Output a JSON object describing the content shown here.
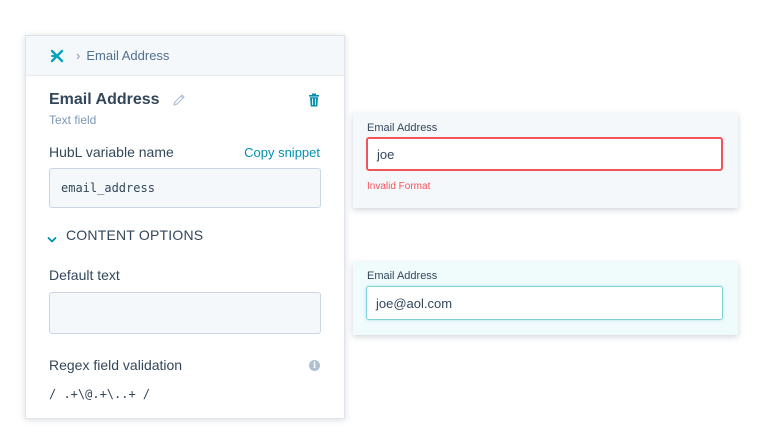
{
  "panel": {
    "breadcrumb_sep": "›",
    "breadcrumb_label": "Email Address",
    "field_title": "Email Address",
    "field_type": "Text field",
    "hubl_label": "HubL variable name",
    "copy_snippet": "Copy snippet",
    "hubl_value": "email_address",
    "content_options": "CONTENT OPTIONS",
    "default_text_label": "Default text",
    "default_text_value": "",
    "regex_label": "Regex field validation",
    "regex_value": "/ .+\\@.+\\..+ /"
  },
  "preview_invalid": {
    "label": "Email Address",
    "value": "joe",
    "error": "Invalid Format"
  },
  "preview_valid": {
    "label": "Email Address",
    "value": "joe@aol.com"
  },
  "colors": {
    "accent": "#0091ae",
    "error": "#f2545b",
    "text": "#33475b",
    "focus": "#7fd1de"
  },
  "icons": [
    "sprocket-icon",
    "chevron-right-icon",
    "pencil-icon",
    "trash-icon",
    "chevron-down-icon",
    "info-icon"
  ]
}
